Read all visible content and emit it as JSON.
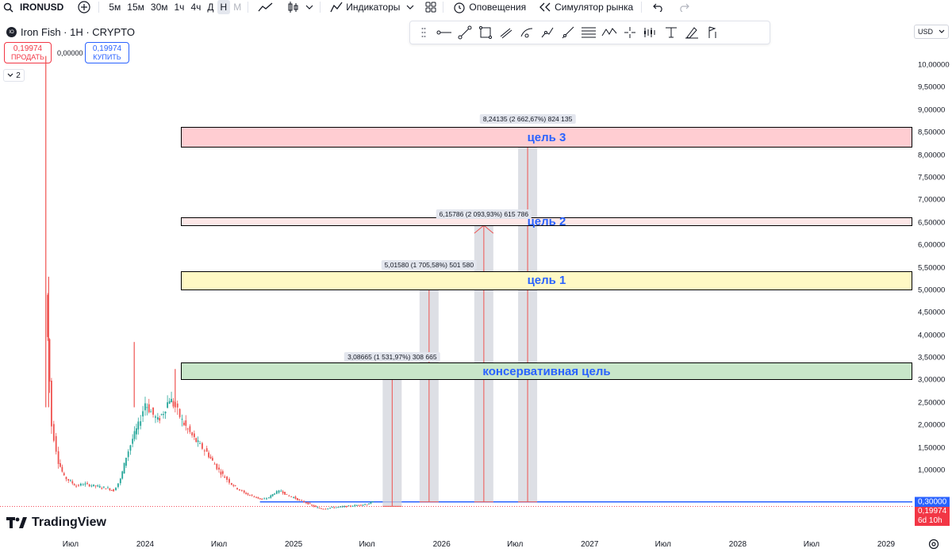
{
  "toolbar": {
    "symbol": "IRONUSD",
    "intervals": [
      "5м",
      "15м",
      "30м",
      "1ч",
      "4ч",
      "Д",
      "Н",
      "М"
    ],
    "selected_interval": "Н",
    "indicators_label": "Индикаторы",
    "alerts_label": "Оповещения",
    "simulator_label": "Симулятор рынка"
  },
  "legend": {
    "coin_badge": "IO",
    "title": "Iron Fish · 1H · CRYPTO",
    "sell_price": "0,19974",
    "sell_label": "ПРОДАТЬ",
    "spread": "0,00000",
    "buy_price": "0,19974",
    "buy_label": "КУПИТЬ",
    "indicator_count": "2"
  },
  "price_scale": {
    "currency": "USD",
    "price_label": "0,19974",
    "countdown": "6d 10h",
    "line_label": "0,30000"
  },
  "branding": {
    "logo_text": "TradingView"
  },
  "colors": {
    "up": "#26a69a",
    "down": "#ef5350",
    "line": "#2962ff",
    "conservative_zone": "#c8e6c9",
    "target1_zone": "#fff9c4",
    "target2_zone": "#fde7e7",
    "target3_zone": "#ffcdd2"
  },
  "chart_data": {
    "type": "candlestick",
    "y_axis": {
      "ticks": [
        "10,00000",
        "9,50000",
        "9,00000",
        "8,50000",
        "8,00000",
        "7,50000",
        "7,00000",
        "6,50000",
        "6,00000",
        "5,50000",
        "5,00000",
        "4,50000",
        "4,00000",
        "3,50000",
        "3,00000",
        "2,50000",
        "2,00000",
        "1,50000",
        "1,00000"
      ],
      "range": [
        0.0,
        10.5
      ]
    },
    "x_axis": {
      "ticks": [
        {
          "label": "Июл",
          "date": "2023-07-01"
        },
        {
          "label": "2024",
          "date": "2024-01-01"
        },
        {
          "label": "Июл",
          "date": "2024-07-01"
        },
        {
          "label": "2025",
          "date": "2025-01-01"
        },
        {
          "label": "Июл",
          "date": "2025-07-01"
        },
        {
          "label": "2026",
          "date": "2026-01-01"
        },
        {
          "label": "Июл",
          "date": "2026-07-01"
        },
        {
          "label": "2027",
          "date": "2027-01-01"
        },
        {
          "label": "Июл",
          "date": "2027-07-01"
        },
        {
          "label": "2028",
          "date": "2028-01-01"
        },
        {
          "label": "Июл",
          "date": "2028-07-01"
        },
        {
          "label": "2029",
          "date": "2029-01-01"
        }
      ]
    },
    "price_series": [
      {
        "date": "2023-05-01",
        "price": 4.9
      },
      {
        "date": "2023-05-15",
        "price": 2.0
      },
      {
        "date": "2023-06-01",
        "price": 1.2
      },
      {
        "date": "2023-06-15",
        "price": 0.85
      },
      {
        "date": "2023-07-01",
        "price": 0.75
      },
      {
        "date": "2023-07-15",
        "price": 0.65
      },
      {
        "date": "2023-08-01",
        "price": 0.7
      },
      {
        "date": "2023-09-01",
        "price": 0.65
      },
      {
        "date": "2023-10-01",
        "price": 0.6
      },
      {
        "date": "2023-10-15",
        "price": 0.55
      },
      {
        "date": "2023-11-01",
        "price": 0.8
      },
      {
        "date": "2023-11-15",
        "price": 1.3
      },
      {
        "date": "2023-12-01",
        "price": 1.7
      },
      {
        "date": "2023-12-15",
        "price": 2.0
      },
      {
        "date": "2024-01-01",
        "price": 2.5
      },
      {
        "date": "2024-01-15",
        "price": 2.3
      },
      {
        "date": "2024-02-01",
        "price": 2.1
      },
      {
        "date": "2024-02-15",
        "price": 2.3
      },
      {
        "date": "2024-03-01",
        "price": 2.6
      },
      {
        "date": "2024-03-15",
        "price": 2.4
      },
      {
        "date": "2024-04-01",
        "price": 2.1
      },
      {
        "date": "2024-04-15",
        "price": 1.9
      },
      {
        "date": "2024-05-01",
        "price": 1.7
      },
      {
        "date": "2024-05-15",
        "price": 1.55
      },
      {
        "date": "2024-06-01",
        "price": 1.4
      },
      {
        "date": "2024-06-15",
        "price": 1.2
      },
      {
        "date": "2024-07-01",
        "price": 1.0
      },
      {
        "date": "2024-07-15",
        "price": 0.85
      },
      {
        "date": "2024-08-01",
        "price": 0.7
      },
      {
        "date": "2024-08-15",
        "price": 0.6
      },
      {
        "date": "2024-09-01",
        "price": 0.5
      },
      {
        "date": "2024-09-15",
        "price": 0.45
      },
      {
        "date": "2024-10-01",
        "price": 0.4
      },
      {
        "date": "2024-10-15",
        "price": 0.35
      },
      {
        "date": "2024-11-01",
        "price": 0.4
      },
      {
        "date": "2024-11-15",
        "price": 0.5
      },
      {
        "date": "2024-12-01",
        "price": 0.55
      },
      {
        "date": "2024-12-15",
        "price": 0.45
      },
      {
        "date": "2025-01-01",
        "price": 0.4
      },
      {
        "date": "2025-01-15",
        "price": 0.33
      },
      {
        "date": "2025-02-01",
        "price": 0.28
      },
      {
        "date": "2025-02-15",
        "price": 0.22
      },
      {
        "date": "2025-03-01",
        "price": 0.17
      },
      {
        "date": "2025-03-15",
        "price": 0.15
      },
      {
        "date": "2025-04-01",
        "price": 0.17
      },
      {
        "date": "2025-05-01",
        "price": 0.19
      },
      {
        "date": "2025-06-01",
        "price": 0.22
      },
      {
        "date": "2025-07-01",
        "price": 0.25
      },
      {
        "date": "2025-07-15",
        "price": 0.3
      }
    ],
    "spikes": [
      {
        "date": "2023-05-01",
        "high": 10.2
      },
      {
        "date": "2023-05-08",
        "high": 5.3
      },
      {
        "date": "2023-12-05",
        "high": 3.85
      },
      {
        "date": "2024-03-15",
        "high": 3.25
      }
    ],
    "horizontal_line": {
      "value": 0.3,
      "from_date": "2024-10-10"
    },
    "zones": [
      {
        "label": "консервативная цель",
        "low": 3.0,
        "high": 3.4
      },
      {
        "label": "цель 1",
        "low": 5.0,
        "high": 5.42
      },
      {
        "label": "цель 2",
        "low": 6.42,
        "high": 6.62
      },
      {
        "label": "цель 3",
        "low": 8.17,
        "high": 8.62
      }
    ],
    "measurements": [
      {
        "date": "2025-09-01",
        "from": 0.2,
        "to": 3.28,
        "label": "3,08665 (1 531,97%) 308 665"
      },
      {
        "date": "2025-12-01",
        "from": 0.3,
        "to": 5.32,
        "label": "5,01580 (1 705,58%) 501 580"
      },
      {
        "date": "2026-04-15",
        "from": 0.3,
        "to": 6.44,
        "label": "6,15786 (2 093,93%) 615 786"
      },
      {
        "date": "2026-08-01",
        "from": 0.3,
        "to": 8.55,
        "label": "8,24135 (2 662,67%) 824 135"
      }
    ]
  }
}
